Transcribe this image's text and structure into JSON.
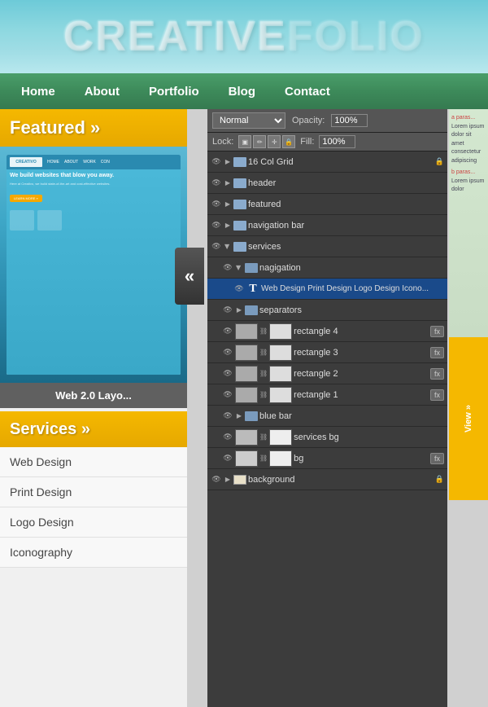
{
  "banner": {
    "title_bold": "CREATIVE",
    "title_light": "FOLIO"
  },
  "nav": {
    "items": [
      "Home",
      "About",
      "Portfolio",
      "Blog",
      "Contact"
    ]
  },
  "featured": {
    "label": "Featured »"
  },
  "thumbnail": {
    "logo": "CREATIVO",
    "nav_items": [
      "HOME",
      "ABOUT",
      "WORK",
      "CON"
    ],
    "headline": "We build websites that blow you away.",
    "sub": "Here at Creativo, we build state-of-the-art and cost-effective websites.",
    "btn": "LEARN MORE »",
    "label": "Web 2.0 Layo..."
  },
  "services": {
    "label": "Services »",
    "items": [
      "Web Design",
      "Print Design",
      "Logo Design",
      "Iconography"
    ]
  },
  "ps_panel": {
    "blend_mode": "Normal",
    "opacity_label": "Opacity:",
    "opacity_val": "100%",
    "lock_label": "Lock:",
    "fill_label": "Fill:",
    "fill_val": "100%",
    "layers": [
      {
        "id": "l1",
        "name": "16 Col Grid",
        "type": "layer",
        "indent": 0,
        "lock": true
      },
      {
        "id": "l2",
        "name": "header",
        "type": "folder",
        "indent": 0,
        "active": false
      },
      {
        "id": "l3",
        "name": "featured",
        "type": "folder",
        "indent": 0
      },
      {
        "id": "l4",
        "name": "navigation bar",
        "type": "folder",
        "indent": 0
      },
      {
        "id": "l5",
        "name": "services",
        "type": "folder",
        "indent": 0
      },
      {
        "id": "l6",
        "name": "nagigation",
        "type": "folder-sub",
        "indent": 1
      },
      {
        "id": "l7",
        "name": "Web Design Print Design Logo Design Icono...",
        "type": "text-active",
        "indent": 2
      },
      {
        "id": "l8",
        "name": "separators",
        "type": "folder",
        "indent": 1
      },
      {
        "id": "l9",
        "name": "rectangle 4",
        "type": "thumb",
        "indent": 1,
        "fx": true
      },
      {
        "id": "l10",
        "name": "rectangle 3",
        "type": "thumb",
        "indent": 1,
        "fx": true
      },
      {
        "id": "l11",
        "name": "rectangle 2",
        "type": "thumb",
        "indent": 1,
        "fx": true
      },
      {
        "id": "l12",
        "name": "rectangle 1",
        "type": "thumb",
        "indent": 1,
        "fx": true
      },
      {
        "id": "l13",
        "name": "blue bar",
        "type": "folder",
        "indent": 1
      },
      {
        "id": "l14",
        "name": "services bg",
        "type": "thumb-link",
        "indent": 1
      },
      {
        "id": "l15",
        "name": "bg",
        "type": "thumb-link-fx",
        "indent": 1
      },
      {
        "id": "l16",
        "name": "background",
        "type": "layer-locked",
        "indent": 0
      }
    ]
  }
}
